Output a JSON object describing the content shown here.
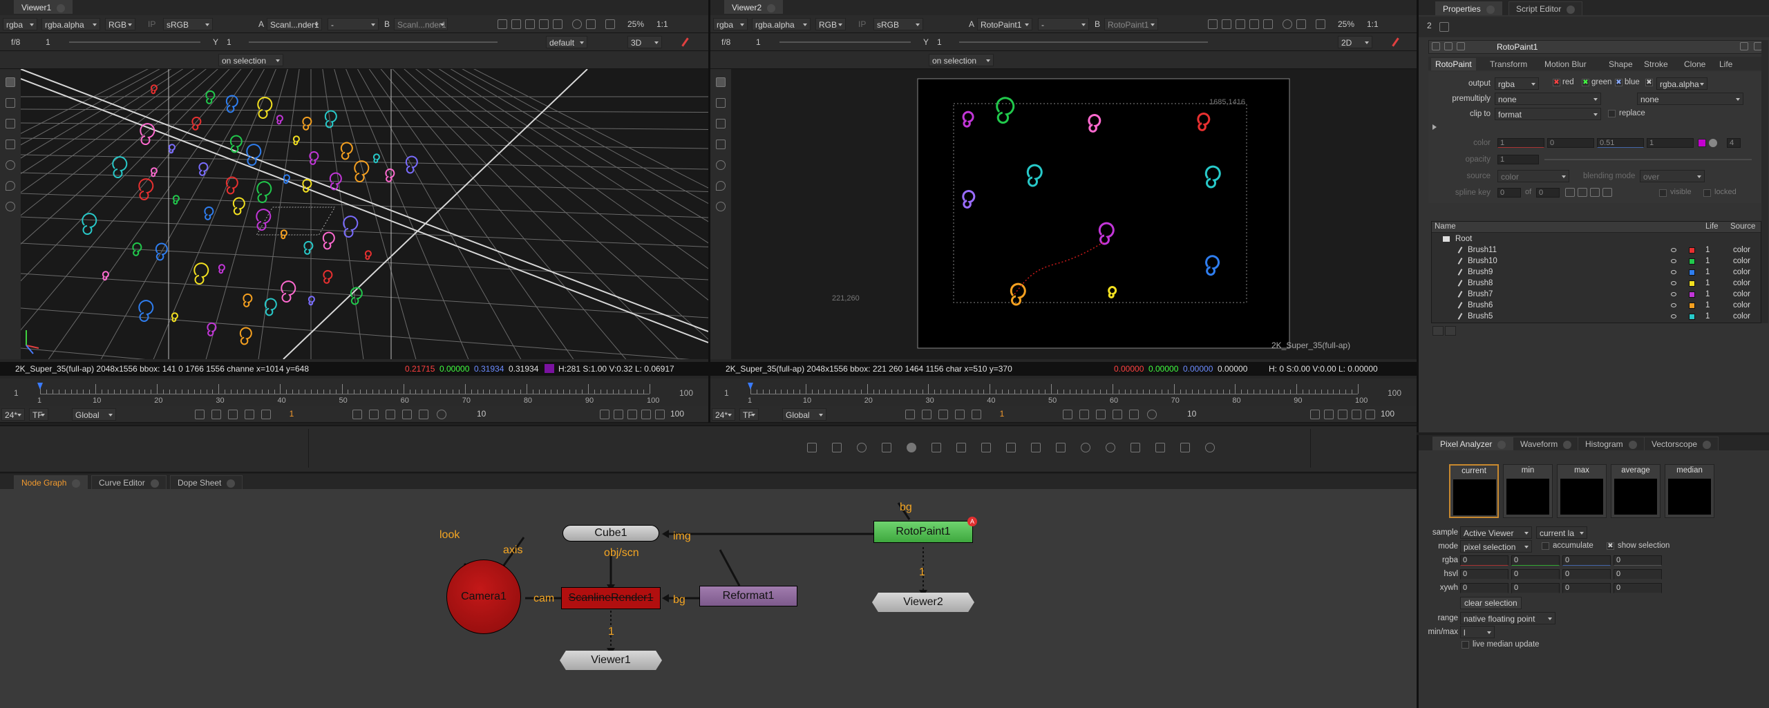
{
  "viewer1": {
    "tab": "Viewer1",
    "channels": "rgba",
    "alpha": "rgba.alpha",
    "rgb": "RGB",
    "ip": "IP",
    "lut": "sRGB",
    "input_a_letter": "A",
    "input_a": "Scanl...nder1",
    "dash_a": "-",
    "input_b_letter": "B",
    "input_b": "Scanl...nder1",
    "zoom": "25%",
    "ratio": "1:1",
    "fstop": "f/8",
    "gain": "1",
    "y_label": "Y",
    "gamma": "1",
    "camera": "default",
    "mode": "3D",
    "roi": "on selection",
    "status": "2K_Super_35(full-ap) 2048x1556  bbox: 141 0 1766 1556 channe  x=1014 y=648",
    "r": "0.21715",
    "g": "0.00000",
    "b": "0.31934",
    "a": "0.31934",
    "hsvl": "H:281 S:1.00 V:0.32  L: 0.06917",
    "format_label": "2K_Super_35(full-ap)",
    "timeline": {
      "start": "1",
      "end": "100",
      "ticks": [
        "1",
        "10",
        "20",
        "30",
        "40",
        "50",
        "60",
        "70",
        "80",
        "90",
        "100"
      ]
    },
    "fps": "24*",
    "tf": "TF",
    "scope": "Global",
    "frame": "1",
    "step": "10",
    "out": "100"
  },
  "viewer2": {
    "tab": "Viewer2",
    "channels": "rgba",
    "alpha": "rgba.alpha",
    "rgb": "RGB",
    "ip": "IP",
    "lut": "sRGB",
    "input_a_letter": "A",
    "input_a": "RotoPaint1",
    "dash_a": "-",
    "input_b_letter": "B",
    "input_b": "RotoPaint1",
    "zoom": "25%",
    "ratio": "1:1",
    "fstop": "f/8",
    "gain": "1",
    "y_label": "Y",
    "gamma": "1",
    "mode": "2D",
    "roi": "on selection",
    "bbox_tr": "1685,1416",
    "bbox_bl": "221,260",
    "format_label": "2K_Super_35(full-ap)",
    "status": "2K_Super_35(full-ap) 2048x1556  bbox: 221 260 1464 1156 char  x=510 y=370",
    "r": "0.00000",
    "g": "0.00000",
    "b": "0.00000",
    "a": "0.00000",
    "hsvl": "H:   0 S:0.00 V:0.00  L: 0.00000",
    "timeline": {
      "start": "1",
      "end": "100",
      "ticks": [
        "1",
        "10",
        "20",
        "30",
        "40",
        "50",
        "60",
        "70",
        "80",
        "90",
        "100"
      ]
    },
    "fps": "24*",
    "tf": "TF",
    "scope": "Global",
    "frame": "1",
    "step": "10",
    "out": "100"
  },
  "nodegraph": {
    "tabs": [
      "Node Graph",
      "Curve Editor",
      "Dope Sheet"
    ],
    "nodes": {
      "camera": "Camera1",
      "cube": "Cube1",
      "scanline": "ScanlineRender1",
      "reformat": "Reformat1",
      "rotopaint": "RotoPaint1",
      "viewer1": "Viewer1",
      "viewer2": "Viewer2"
    },
    "pipes": {
      "look": "look",
      "axis": "axis",
      "cam": "cam",
      "objscn": "obj/scn",
      "img": "img",
      "bg1": "bg",
      "bg2": "bg",
      "in1": "1",
      "in2": "1"
    }
  },
  "properties": {
    "tabs": [
      "Properties",
      "Script Editor"
    ],
    "count": "2",
    "node_name": "RotoPaint1",
    "subtabs": [
      "RotoPaint",
      "Transform",
      "Motion Blur",
      "Shape",
      "Stroke",
      "Clone",
      "Life"
    ],
    "output_label": "output",
    "output": "rgba",
    "red": "red",
    "green": "green",
    "blue": "blue",
    "output_alpha": "rgba.alpha",
    "premult_label": "premultiply",
    "premult": "none",
    "premult2": "none",
    "clip_label": "clip to",
    "clip": "format",
    "replace": "replace",
    "color_label": "color",
    "color_vals": [
      "1",
      "0",
      "0.51",
      "1"
    ],
    "color_n": "4",
    "opacity_label": "opacity",
    "opacity": "1",
    "source_label": "source",
    "source": "color",
    "blend_label": "blending mode",
    "blend": "over",
    "spline_label": "spline key",
    "spline_val": "0",
    "of": "of",
    "of_val": "0",
    "visible": "visible",
    "locked": "locked",
    "cols": [
      "Name",
      "Life",
      "Source"
    ],
    "root": "Root",
    "rows": [
      {
        "name": "Brush11",
        "life": "1",
        "src": "color",
        "col": "#e83030"
      },
      {
        "name": "Brush10",
        "life": "1",
        "src": "color",
        "col": "#21c94c"
      },
      {
        "name": "Brush9",
        "life": "1",
        "src": "color",
        "col": "#2f7ef0"
      },
      {
        "name": "Brush8",
        "life": "1",
        "src": "color",
        "col": "#f2e020"
      },
      {
        "name": "Brush7",
        "life": "1",
        "src": "color",
        "col": "#c236d8"
      },
      {
        "name": "Brush6",
        "life": "1",
        "src": "color",
        "col": "#f5a020"
      },
      {
        "name": "Brush5",
        "life": "1",
        "src": "color",
        "col": "#28c9c9"
      }
    ]
  },
  "analyzer": {
    "tabs": [
      "Pixel Analyzer",
      "Waveform",
      "Histogram",
      "Vectorscope"
    ],
    "swatches": [
      "current",
      "min",
      "max",
      "average",
      "median"
    ],
    "sample_label": "sample",
    "sample": "Active Viewer",
    "sample2": "current la",
    "mode_label": "mode",
    "mode": "pixel selection",
    "accumulate": "accumulate",
    "show_selection": "show selection",
    "rgba_label": "rgba",
    "hsvl_label": "hsvl",
    "xywh_label": "xywh",
    "rgba": [
      "0",
      "0",
      "0",
      "0"
    ],
    "hsvl": [
      "0",
      "0",
      "0",
      "0"
    ],
    "xywh": [
      "0",
      "0",
      "0",
      "0"
    ],
    "clear": "clear selection",
    "range_label": "range",
    "range": "native floating point",
    "minmax_label": "min/max",
    "minmax": "l",
    "live": "live median update"
  }
}
